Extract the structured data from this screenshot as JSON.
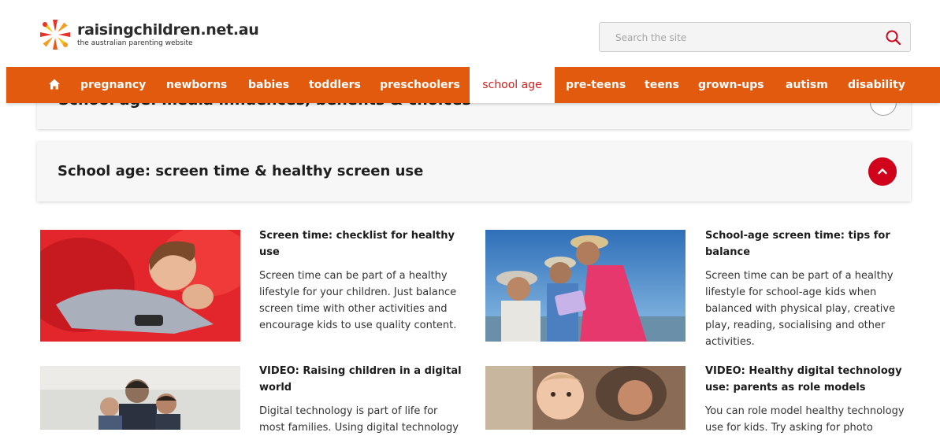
{
  "header": {
    "logo_name": "raisingchildren.net.au",
    "logo_tagline": "the australian parenting website",
    "search_placeholder": "Search the site"
  },
  "nav": {
    "items": [
      "pregnancy",
      "newborns",
      "babies",
      "toddlers",
      "preschoolers",
      "school age",
      "pre-teens",
      "teens",
      "grown-ups",
      "autism",
      "disability"
    ],
    "active": "school age"
  },
  "sections": [
    {
      "title": "School age: media influences, benefits & choices",
      "expanded": false
    },
    {
      "title": "School age: screen time & healthy screen use",
      "expanded": true
    }
  ],
  "articles": [
    {
      "title": "Screen time: checklist for healthy use",
      "desc": "Screen time can be part of a healthy lifestyle for your children. Just balance screen time with other activities and encourage kids to use quality content."
    },
    {
      "title": "School-age screen time: tips for balance",
      "desc": "Screen time can be part of a healthy lifestyle for school-age kids when balanced with physical play, creative play, reading, socialising and other activities."
    },
    {
      "title": "VIDEO: Raising children in a digital world",
      "desc": "Digital technology is part of life for most families. Using digital technology"
    },
    {
      "title": "VIDEO: Healthy digital technology use: parents as role models",
      "desc": "You can role model healthy technology use for kids. Try asking for photo"
    }
  ],
  "colors": {
    "nav_bg": "#e25a0d",
    "active_text": "#d41e1e",
    "toggle_red": "#d0021b"
  },
  "icons": [
    "logo-burst-icon",
    "search-icon",
    "home-icon",
    "chevron-up-icon",
    "chevron-down-icon"
  ]
}
